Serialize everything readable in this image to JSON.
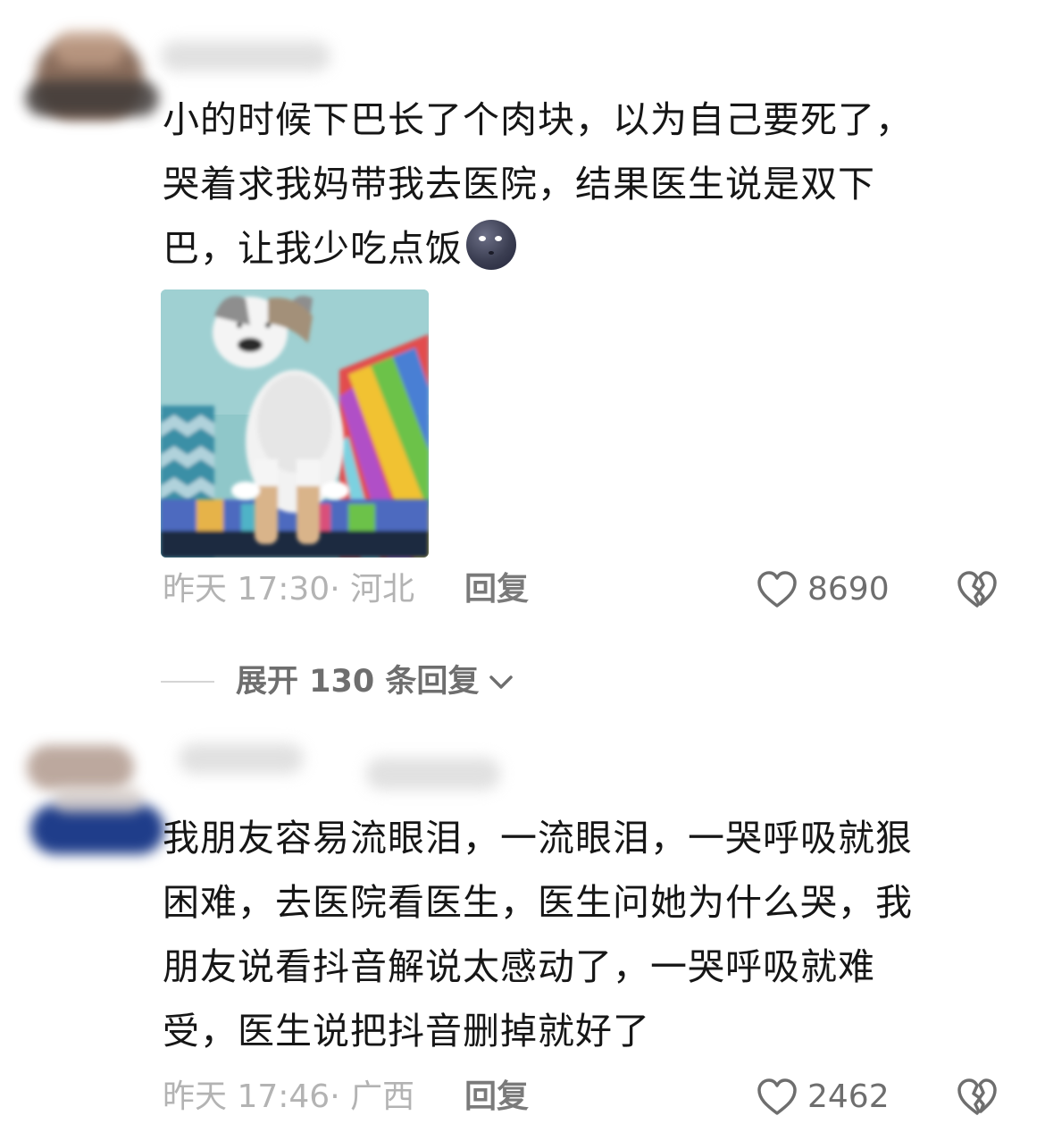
{
  "comments": [
    {
      "text_lines": [
        "小的时候下巴长了个肉块，以为自己要死了，",
        "哭着求我妈带我去医院，结果医生说是双下",
        "巴，让我少吃点饭"
      ],
      "emoji": "new-moon-face",
      "meta": "昨天 17:30· 河北",
      "reply_label": "回复",
      "likes": "8690"
    },
    {
      "text_lines": [
        "我朋友容易流眼泪，一流眼泪，一哭呼吸就狠",
        "困难，去医院看医生，医生问她为什么哭，我",
        "朋友说看抖音解说太感动了，一哭呼吸就难",
        "受，医生说把抖音删掉就好了"
      ],
      "meta": "昨天 17:46· 广西",
      "reply_label": "回复",
      "likes": "2462"
    }
  ],
  "expand_replies": {
    "label": "展开 130 条回复"
  },
  "colors": {
    "text": "#161616",
    "meta": "#b3b3b3",
    "action": "#6e6e6e"
  }
}
